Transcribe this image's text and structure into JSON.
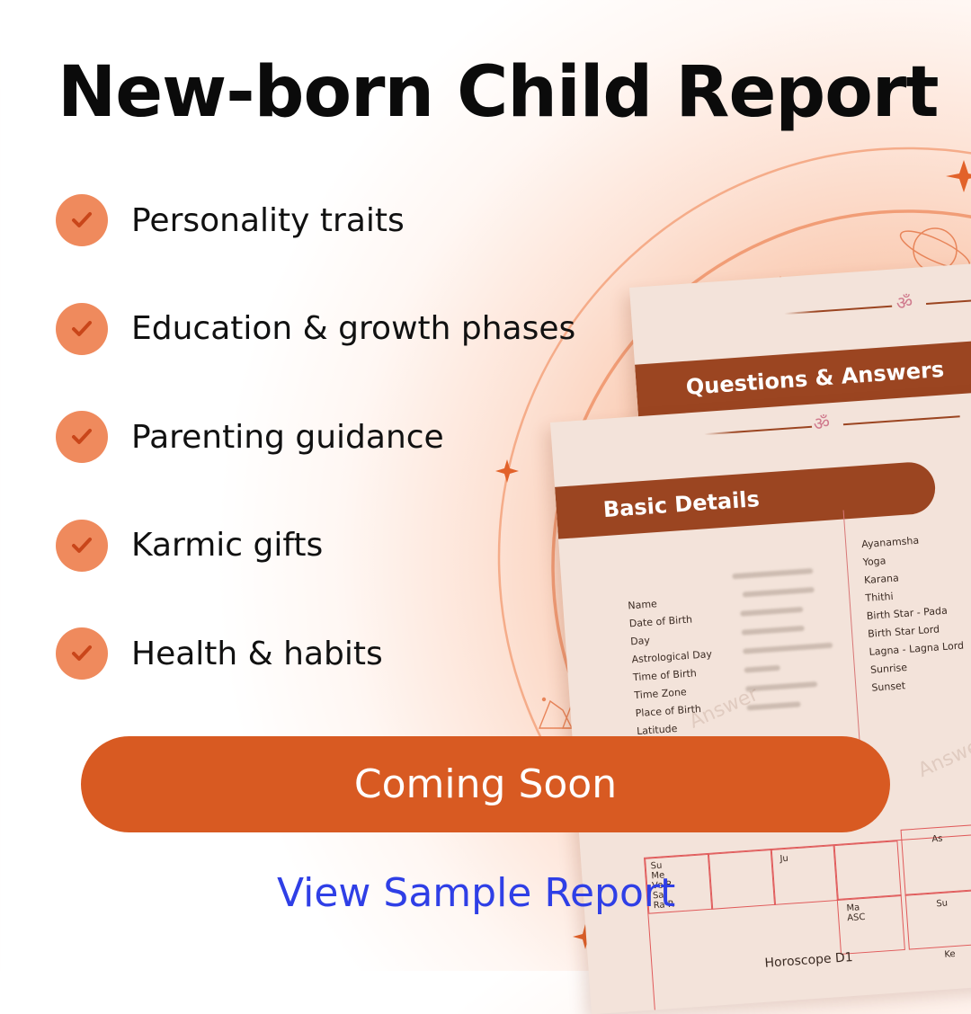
{
  "title": "New-born Child Report",
  "features": [
    {
      "label": "Personality traits"
    },
    {
      "label": "Education & growth phases"
    },
    {
      "label": "Parenting guidance"
    },
    {
      "label": "Karmic gifts"
    },
    {
      "label": "Health & habits"
    }
  ],
  "preview": {
    "om_symbol": "ॐ",
    "back_page_heading": "Questions & Answers",
    "front_page_heading": "Basic Details",
    "left_fields": [
      "Name",
      "Date of Birth",
      "Day",
      "Astrological Day",
      "Time of Birth",
      "Time Zone",
      "Place of Birth",
      "Latitude"
    ],
    "right_fields": [
      "Ayanamsha",
      "Yoga",
      "Karana",
      "Thithi",
      "Birth Star - Pada",
      "Birth Star Lord",
      "Lagna - Lagna Lord",
      "Sunrise",
      "Sunset"
    ],
    "watermark": "Answer",
    "chart_cells": {
      "c1": "Su\nMe\nVe R\nSa\nRa R",
      "c2": "Ju",
      "c3": "As",
      "c4": "Ma\nASC",
      "c5": "Su",
      "c6": "Ke"
    },
    "chart_caption": "Horoscope D1"
  },
  "cta": {
    "label": "Coming Soon"
  },
  "sample_link": {
    "label": "View Sample Report"
  },
  "colors": {
    "accent": "#d85a22",
    "check": "#ef8a5d",
    "header_bar": "#9b4521",
    "link": "#2f3fe6"
  }
}
